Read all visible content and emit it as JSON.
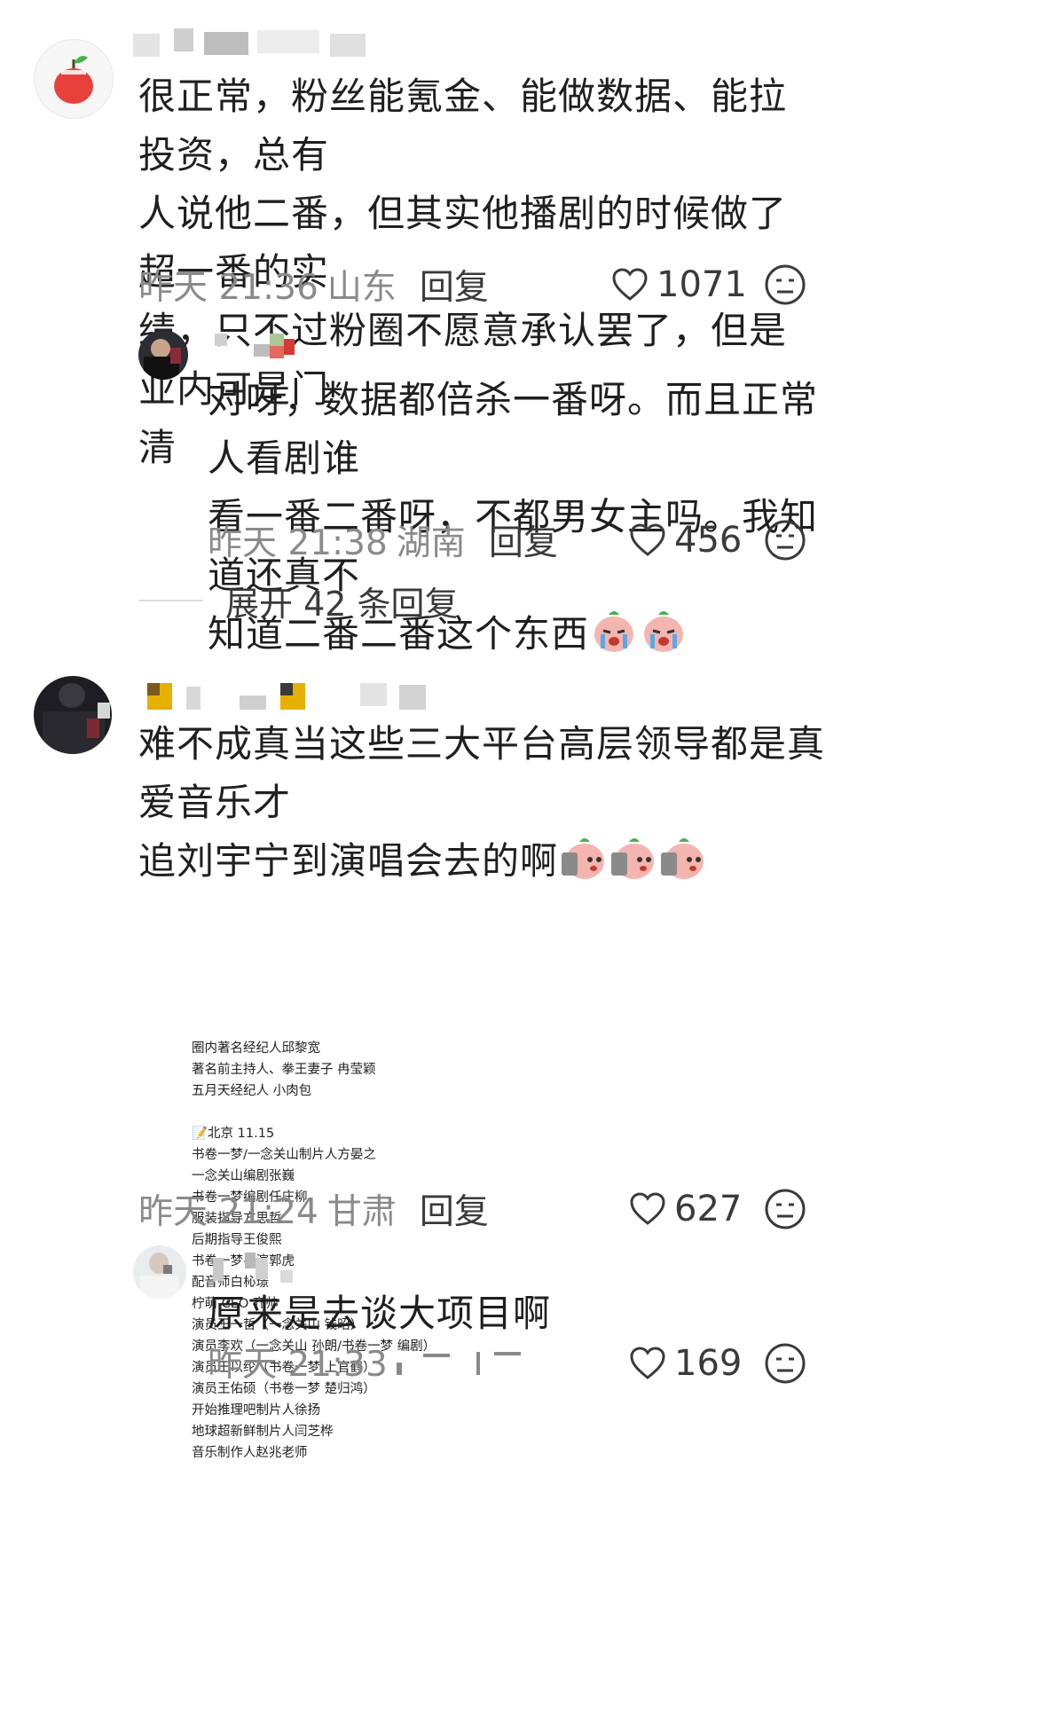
{
  "comments": [
    {
      "text_lines": [
        "很正常，粉丝能氪金、能做数据、能拉投资，总有",
        "人说他二番，但其实他播剧的时候做了超一番的实",
        "绩，只不过粉圈不愿意承认罢了，但是业内可是门",
        "清"
      ],
      "time": "昨天 21:36",
      "location": "山东",
      "reply_label": "回复",
      "likes": "1071",
      "avatar_icon": "apple-icon"
    },
    {
      "text_lines": [
        "对呀，数据都倍杀一番呀。而且正常人看剧谁",
        "看一番二番呀，不都男女主吗。我知道还真不",
        "知道二番二番这个东西"
      ],
      "time": "昨天 21:38",
      "location": "湖南",
      "reply_label": "回复",
      "likes": "456",
      "emoji": "crying-face-icon"
    },
    {
      "text_lines": [
        "难不成真当这些三大平台高层领导都是真爱音乐才",
        "追刘宇宁到演唱会去的啊"
      ],
      "time": "昨天 21:24",
      "location": "甘肃",
      "reply_label": "回复",
      "likes": "627",
      "emoji": "phone-face-icon"
    },
    {
      "text_lines": [
        "原来是去谈大项目啊"
      ],
      "time": "昨天 21:33",
      "location": "",
      "reply_label": "",
      "likes": "169"
    }
  ],
  "expand_label": "展开 42 条回复",
  "screenshot_lines": [
    "圈内著名经纪人邱黎宽",
    "著名前主持人、拳王妻子 冉莹颖",
    "五月天经纪人 小肉包",
    "",
    "📝北京 11.15",
    "书卷一梦/一念关山制片人方晏之",
    "一念关山编剧张巍",
    "书卷一梦编剧任庄柳",
    "服装指导方思哲",
    "后期指导王俊熙",
    "书卷一梦导演郭虎",
    "配音师白杺璟",
    "柠萌 CEO 齐帅",
    "演员王一哲（一念关山 钱昭）",
    "演员李欢（一念关山 孙朗/书卷一梦 编剧）",
    "演员王以纶（书卷一梦 上官鹤）",
    "演员王佑硕（书卷一梦 楚归鸿）",
    "开始推理吧制片人徐扬",
    "地球超新鲜制片人闫芝桦",
    "音乐制作人赵兆老师"
  ],
  "colors": {
    "text": "#1f1f1f",
    "meta": "#8a8a8a",
    "accent_red": "#e8403a"
  }
}
